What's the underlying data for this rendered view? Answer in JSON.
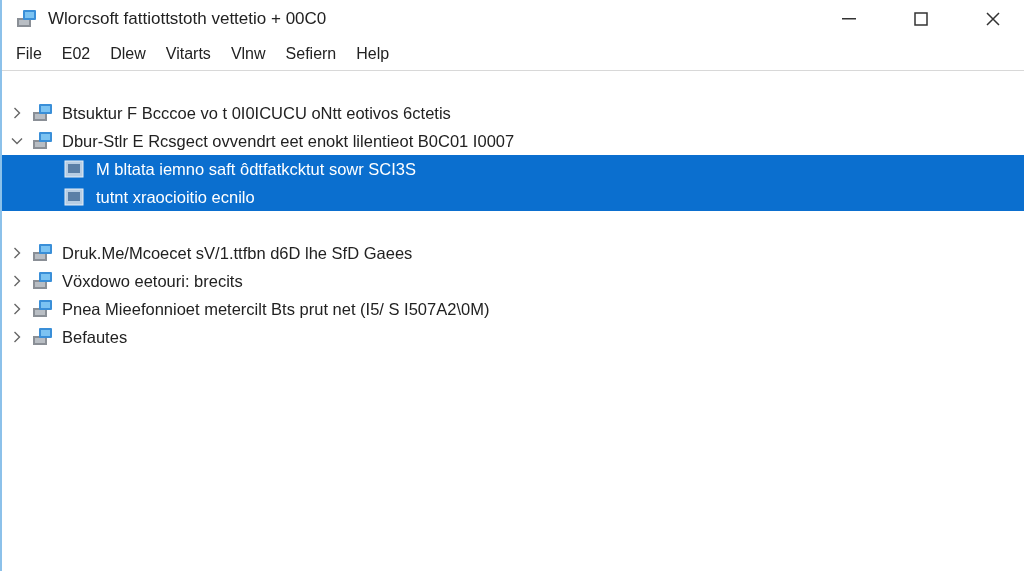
{
  "window": {
    "title": "Wlorcsoft fattiottstoth vettetio + 00C0"
  },
  "menu": [
    "File",
    "E02",
    "Dlew",
    "Vitarts",
    "Vlnw",
    "Sefiern",
    "Help"
  ],
  "tree": [
    {
      "label": "Btsuktur F Bcccoe vo t 0I0ICUCU oNtt eotivos 6ctetis",
      "expanded": false,
      "selected": false
    },
    {
      "label": "Dbur-Stlr E Rcsgect ovvendrt eet enokt lilentieot B0C01 I0007",
      "expanded": true,
      "selected": false,
      "children": [
        {
          "label": "M bltata iemno saft ôdtfatkcktut sowr SCI3S",
          "selected": true
        },
        {
          "label": "tutnt xraocioitio ecnilo",
          "selected": true
        }
      ]
    },
    {
      "label": "Druk.Me/Mcoecet sV/1.ttfbn d6D lhe SfD Gaees",
      "expanded": false,
      "selected": false
    },
    {
      "label": "Vöxdowo eetouri: brecits",
      "expanded": false,
      "selected": false
    },
    {
      "label": "Pnea Mieefonnioet metercilt Bts prut net (I5/ S I507A2\\0M)",
      "expanded": false,
      "selected": false
    },
    {
      "label": "Befautes",
      "expanded": false,
      "selected": false
    }
  ]
}
